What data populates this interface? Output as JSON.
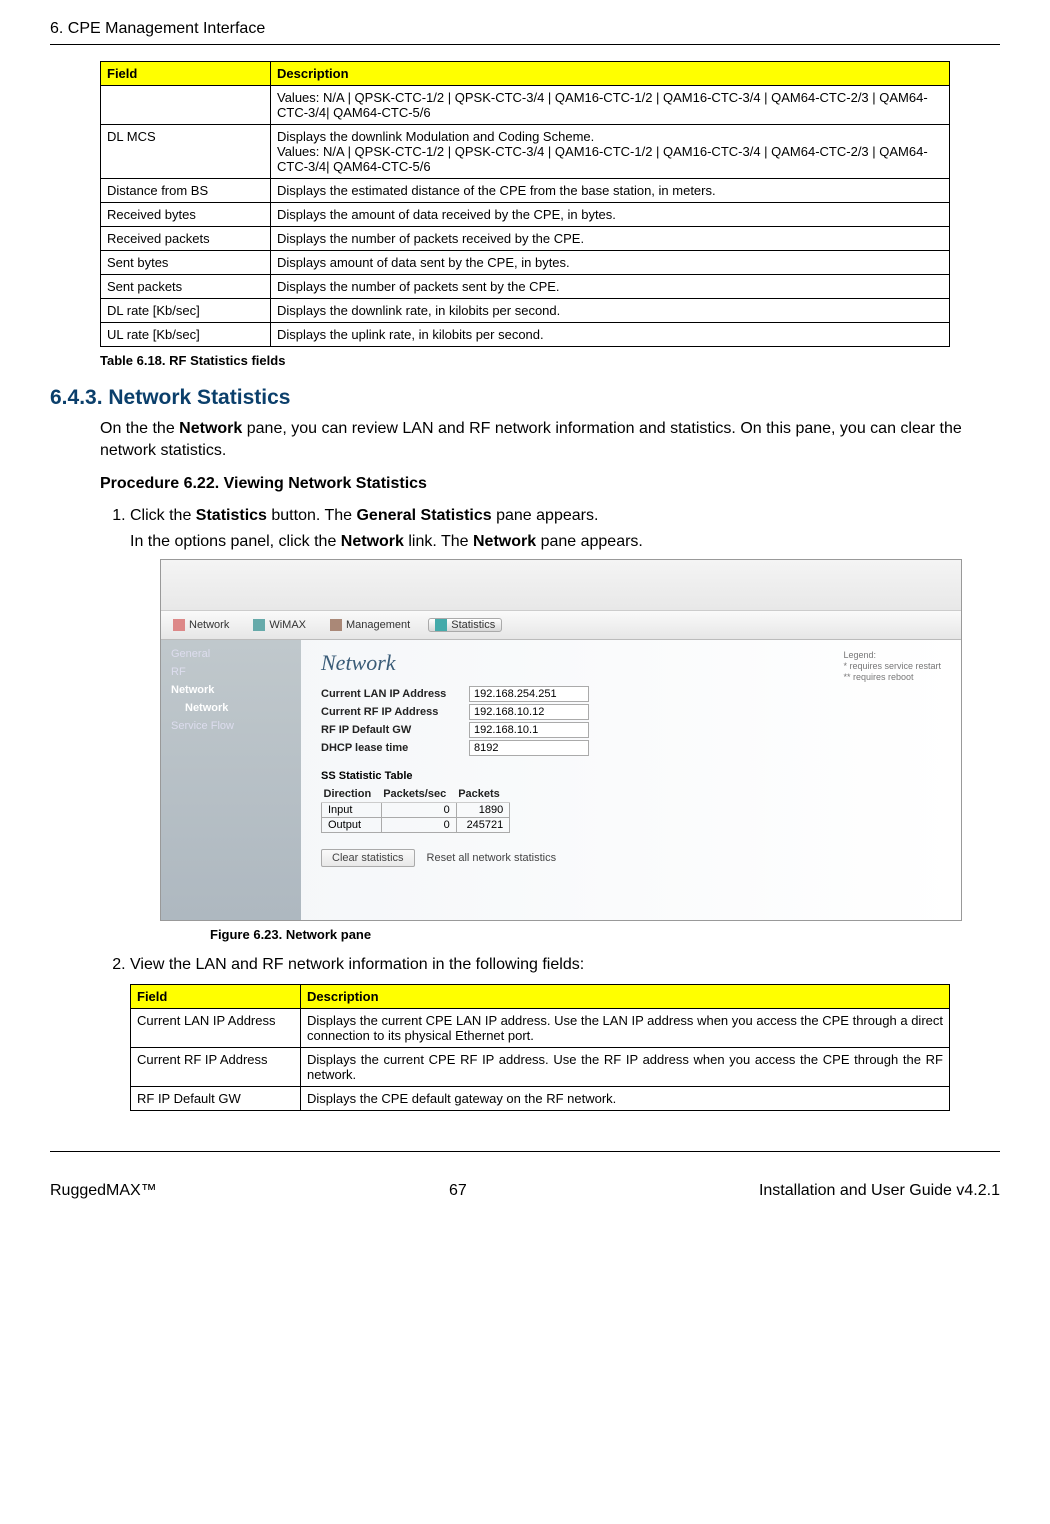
{
  "header": {
    "title": "6. CPE Management Interface"
  },
  "table1": {
    "headers": [
      "Field",
      "Description"
    ],
    "rows": [
      [
        "",
        "Values: N/A | QPSK-CTC-1/2 | QPSK-CTC-3/4 | QAM16-CTC-1/2 | QAM16-CTC-3/4 | QAM64-CTC-2/3 | QAM64-CTC-3/4| QAM64-CTC-5/6"
      ],
      [
        "DL MCS",
        "Displays the downlink Modulation and Coding Scheme.\nValues: N/A | QPSK-CTC-1/2 | QPSK-CTC-3/4 | QAM16-CTC-1/2 | QAM16-CTC-3/4 | QAM64-CTC-2/3 | QAM64-CTC-3/4| QAM64-CTC-5/6"
      ],
      [
        "Distance from BS",
        "Displays the estimated distance of the CPE from the base station, in meters."
      ],
      [
        "Received bytes",
        "Displays the amount of data received by the CPE, in bytes."
      ],
      [
        "Received packets",
        "Displays the number of packets received by the CPE."
      ],
      [
        "Sent bytes",
        "Displays amount of data sent by the CPE, in bytes."
      ],
      [
        "Sent packets",
        "Displays the number of packets sent by the CPE."
      ],
      [
        "DL rate [Kb/sec]",
        "Displays the downlink rate, in kilobits per second."
      ],
      [
        "UL rate [Kb/sec]",
        "Displays the uplink rate, in kilobits per second."
      ]
    ],
    "caption": "Table 6.18. RF Statistics fields"
  },
  "section": {
    "heading": "6.4.3.  Network Statistics",
    "intro_html": "On the the <b>Network</b> pane, you can review LAN and RF network information and statistics. On this pane, you can clear the network statistics.",
    "procedure_title": "Procedure 6.22. Viewing Network Statistics",
    "step1_p1_html": "Click the <b>Statistics</b> button. The <b>General Statistics</b> pane appears.",
    "step1_p2_html": "In the options panel, click the <b>Network</b> link. The <b>Network</b> pane appears.",
    "step2_html": "View the LAN and RF network information in the following fields:"
  },
  "screenshot": {
    "nav": [
      "Network",
      "WiMAX",
      "Management",
      "Statistics"
    ],
    "side": {
      "items": [
        "General",
        "RF",
        "Network",
        "Service Flow"
      ],
      "sub_item": "Network"
    },
    "main": {
      "title": "Network",
      "legend": "Legend:\n* requires service restart\n** requires reboot",
      "fields": [
        [
          "Current LAN IP Address",
          "192.168.254.251"
        ],
        [
          "Current RF IP Address",
          "192.168.10.12"
        ],
        [
          "RF IP Default GW",
          "192.168.10.1"
        ],
        [
          "DHCP lease time",
          "8192"
        ]
      ],
      "ss_table_title": "SS Statistic Table",
      "ss_table_headers": [
        "Direction",
        "Packets/sec",
        "Packets"
      ],
      "ss_table_rows": [
        [
          "Input",
          "0",
          "1890"
        ],
        [
          "Output",
          "0",
          "245721"
        ]
      ],
      "button": "Clear statistics",
      "button_desc": "Reset all network statistics"
    }
  },
  "fig_caption": "Figure 6.23. Network pane",
  "table2": {
    "headers": [
      "Field",
      "Description"
    ],
    "rows": [
      [
        "Current LAN IP Address",
        "Displays the current CPE LAN IP address. Use the LAN IP address when you access the CPE through a direct connection to its physical Ethernet port."
      ],
      [
        "Current RF IP Address",
        "Displays the current CPE RF IP address. Use the RF IP address when you access the CPE through the RF network."
      ],
      [
        "RF IP Default GW",
        "Displays the CPE default gateway on the RF network."
      ]
    ]
  },
  "footer": {
    "left": "RuggedMAX™",
    "center": "67",
    "right": "Installation and User Guide v4.2.1"
  }
}
